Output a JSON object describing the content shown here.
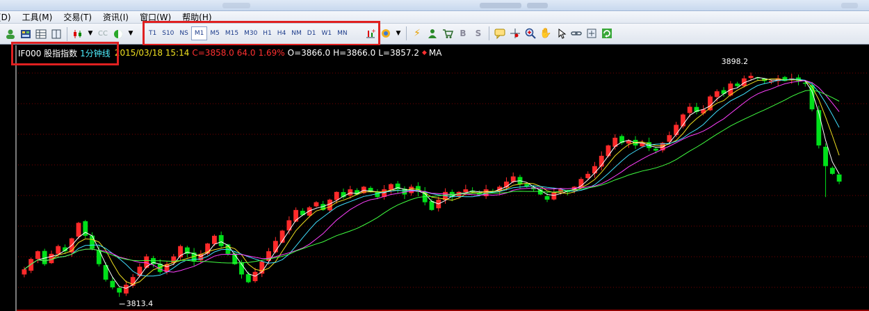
{
  "menu": [
    {
      "label": "(D)"
    },
    {
      "label": "工具(M)"
    },
    {
      "label": "交易(T)"
    },
    {
      "label": "资讯(I)"
    },
    {
      "label": "窗口(W)"
    },
    {
      "label": "帮助(H)"
    }
  ],
  "timeframes": [
    "T1",
    "S10",
    "NS",
    "M1",
    "M5",
    "M15",
    "M30",
    "H1",
    "H4",
    "NM",
    "D1",
    "W1",
    "MN"
  ],
  "active_timeframe": "M1",
  "info": {
    "symbol": "IF000 股指指数",
    "period": "1分钟线",
    "datetime": "2015/03/18 15:14",
    "close": "C=3858.0",
    "change": "64.0",
    "change_pct": "1.69%",
    "open": "O=3866.0",
    "high": "H=3866.0",
    "low": "L=3857.2",
    "indicator": "MA"
  },
  "colors": {
    "up": "#ff2a2a",
    "down": "#00e01a",
    "ma_fast": "#ffffff",
    "ma_mid1": "#f0e020",
    "ma_mid2": "#ff40ff",
    "ma_mid3": "#40e0ff",
    "ma_slow": "#40ff40",
    "grid": "#7a0000",
    "highlight": "#e02020"
  },
  "chart_data": {
    "type": "candlestick",
    "ylim": [
      3808,
      3904
    ],
    "max_label": "3898.2",
    "min_label": "3813.4",
    "series": [
      {
        "name": "MA"
      }
    ],
    "close": [
      3822,
      3826,
      3829,
      3824,
      3828,
      3831,
      3829,
      3834,
      3840,
      3835,
      3830,
      3824,
      3818,
      3815,
      3813,
      3816,
      3819,
      3823,
      3827,
      3824,
      3821,
      3824,
      3827,
      3831,
      3828,
      3825,
      3828,
      3832,
      3835,
      3831,
      3828,
      3824,
      3820,
      3817,
      3821,
      3825,
      3829,
      3833,
      3837,
      3841,
      3845,
      3843,
      3846,
      3848,
      3845,
      3849,
      3852,
      3850,
      3853,
      3851,
      3854,
      3852,
      3850,
      3853,
      3855,
      3853,
      3851,
      3854,
      3852,
      3848,
      3845,
      3849,
      3852,
      3850,
      3852,
      3853,
      3852,
      3851,
      3853,
      3852,
      3854,
      3856,
      3858,
      3855,
      3854,
      3853,
      3851,
      3849,
      3852,
      3853,
      3852,
      3854,
      3857,
      3859,
      3862,
      3866,
      3870,
      3873,
      3871,
      3872,
      3870,
      3871,
      3869,
      3868,
      3871,
      3874,
      3878,
      3882,
      3885,
      3883,
      3884,
      3889,
      3891,
      3890,
      3894,
      3893,
      3896,
      3897,
      3896,
      3895,
      3895,
      3896,
      3895,
      3896,
      3895,
      3894,
      3884,
      3870,
      3862,
      3859,
      3856
    ]
  }
}
